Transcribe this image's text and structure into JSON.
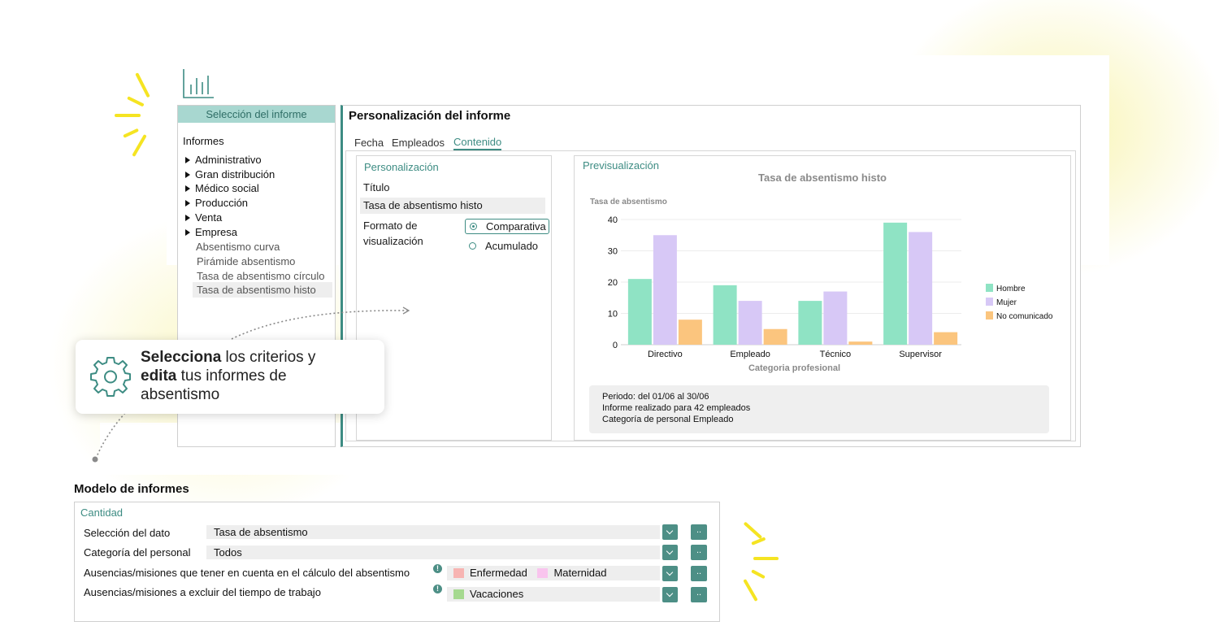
{
  "left": {
    "header": "Selección del informe",
    "title": "Informes",
    "categories": [
      "Administrativo",
      "Gran distribución",
      "Médico social",
      "Producción",
      "Venta",
      "Empresa"
    ],
    "sub_items": [
      "Absentismo curva",
      "Pirámide absentismo",
      "Tasa de absentismo círculo",
      "Tasa de absentismo histo"
    ]
  },
  "main": {
    "title": "Personalización del informe",
    "tabs": [
      "Fecha",
      "Empleados",
      "Contenido"
    ],
    "active_tab": "Contenido",
    "personalizacion": {
      "heading": "Personalización",
      "titulo_label": "Título",
      "titulo_value": "Tasa de absentismo histo",
      "formato_label_1": "Formato de",
      "formato_label_2": "visualización",
      "options": [
        "Comparativa",
        "Acumulado"
      ],
      "selected": "Comparativa"
    },
    "preview": {
      "heading": "Previsualización",
      "info_lines": [
        "Periodo: del 01/06 al 30/06",
        "Informe realizado para 42 empleados",
        "Categoría de personal Empleado"
      ]
    }
  },
  "chart_data": {
    "type": "bar",
    "title": "Tasa de absentismo histo",
    "ylabel": "Tasa de absentismo",
    "xlabel": "Categoria profesional",
    "categories": [
      "Directivo",
      "Empleado",
      "Técnico",
      "Supervisor"
    ],
    "ylim": [
      0,
      40
    ],
    "yticks": [
      0,
      10,
      20,
      30,
      40
    ],
    "grid": true,
    "legend": "right",
    "series": [
      {
        "name": "Hombre",
        "color": "#8fe3c4",
        "values": [
          21,
          19,
          14,
          39
        ]
      },
      {
        "name": "Mujer",
        "color": "#d7c8f6",
        "values": [
          35,
          14,
          17,
          36
        ]
      },
      {
        "name": "No comunicado",
        "color": "#fbc57e",
        "values": [
          8,
          5,
          1,
          4
        ]
      }
    ]
  },
  "callout": {
    "bold1": "Selecciona",
    "text1": " los criterios y",
    "bold2": "edita",
    "text2": " tus informes de",
    "text3": "absentismo"
  },
  "bottom": {
    "title": "Modelo de informes",
    "section": "Cantidad",
    "rows": [
      {
        "label": "Selección del dato",
        "value": "Tasa de absentismo"
      },
      {
        "label": "Categoría del personal",
        "value": "Todos"
      },
      {
        "label": "Ausencias/misiones que tener en cuenta en el cálculo del absentismo"
      },
      {
        "label": "Ausencias/misiones a excluir del tiempo de trabajo"
      }
    ],
    "chips_row3": [
      {
        "label": "Enfermedad",
        "color": "#f7b4b2"
      },
      {
        "label": "Maternidad",
        "color": "#f9c4ee"
      }
    ],
    "chips_row4": [
      {
        "label": "Vacaciones",
        "color": "#a5d98f"
      }
    ],
    "dots_label": ".."
  },
  "accent_color": "#3d8c83"
}
